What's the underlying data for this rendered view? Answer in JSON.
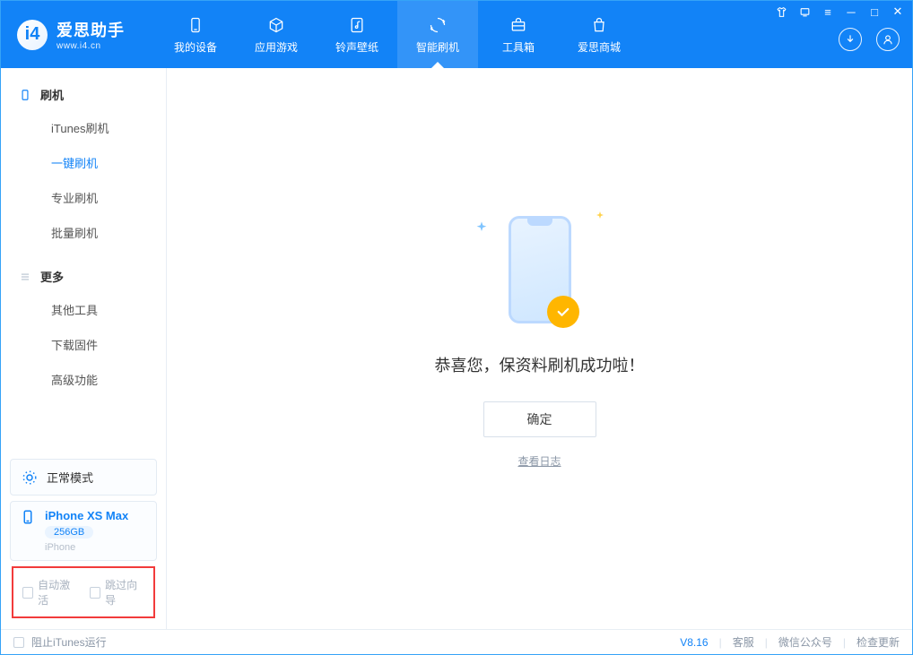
{
  "app": {
    "title": "爱思助手",
    "subtitle": "www.i4.cn"
  },
  "tabs": [
    {
      "label": "我的设备"
    },
    {
      "label": "应用游戏"
    },
    {
      "label": "铃声壁纸"
    },
    {
      "label": "智能刷机"
    },
    {
      "label": "工具箱"
    },
    {
      "label": "爱思商城"
    }
  ],
  "sidebar": {
    "sections": [
      {
        "title": "刷机",
        "items": [
          "iTunes刷机",
          "一键刷机",
          "专业刷机",
          "批量刷机"
        ]
      },
      {
        "title": "更多",
        "items": [
          "其他工具",
          "下载固件",
          "高级功能"
        ]
      }
    ],
    "status": {
      "mode": "正常模式"
    },
    "device": {
      "name": "iPhone XS Max",
      "storage": "256GB",
      "type": "iPhone"
    },
    "options": {
      "auto_activate": "自动激活",
      "skip_guide": "跳过向导"
    }
  },
  "main": {
    "success_msg": "恭喜您，保资料刷机成功啦！",
    "ok_btn": "确定",
    "view_log": "查看日志"
  },
  "footer": {
    "block_itunes": "阻止iTunes运行",
    "version": "V8.16",
    "links": [
      "客服",
      "微信公众号",
      "检查更新"
    ]
  }
}
